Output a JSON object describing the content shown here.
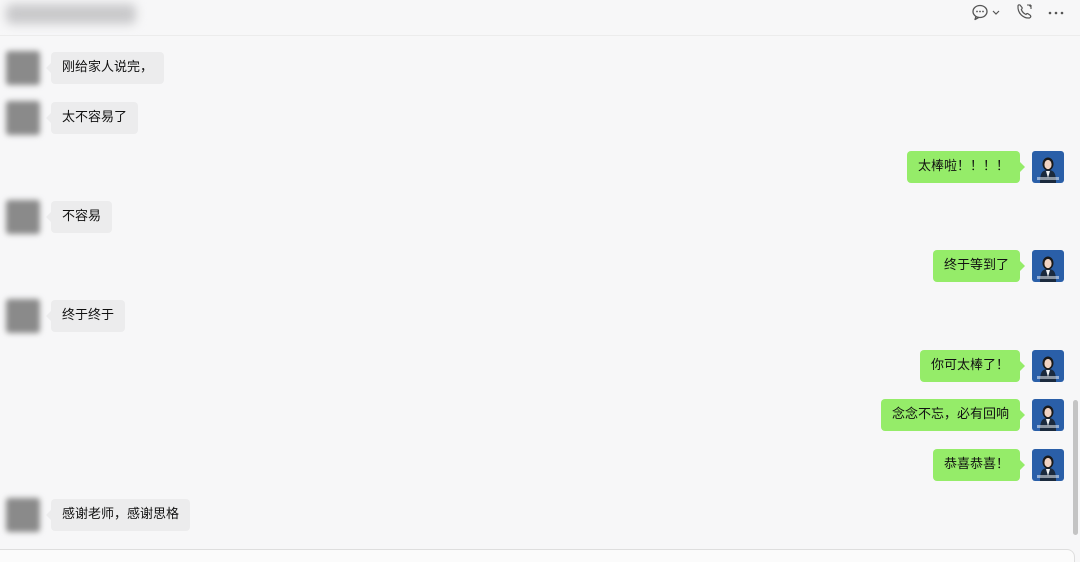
{
  "header": {
    "icons": [
      "chat-bubble-icon",
      "chevron-down-icon",
      "phone-icon",
      "more-icon"
    ]
  },
  "colors": {
    "background": "#f7f7f8",
    "incoming_bubble": "#ececed",
    "outgoing_bubble": "#95ec69",
    "avatar_blue": "#2a5fa8"
  },
  "messages": [
    {
      "direction": "in",
      "text": "刚给家人说完，"
    },
    {
      "direction": "in",
      "text": "太不容易了"
    },
    {
      "direction": "out",
      "text": "太棒啦！！！！"
    },
    {
      "direction": "in",
      "text": "不容易"
    },
    {
      "direction": "out",
      "text": "终于等到了"
    },
    {
      "direction": "in",
      "text": "终于终于"
    },
    {
      "direction": "out",
      "text": "你可太棒了！"
    },
    {
      "direction": "out",
      "text": "念念不忘，必有回响"
    },
    {
      "direction": "out",
      "text": "恭喜恭喜！"
    },
    {
      "direction": "in",
      "text": "感谢老师，感谢思格"
    }
  ]
}
